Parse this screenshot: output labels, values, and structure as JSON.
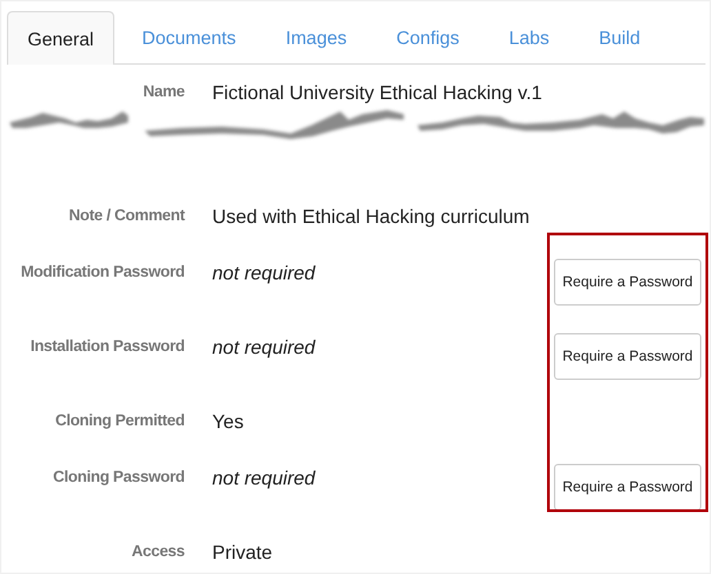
{
  "tabs": [
    {
      "label": "General",
      "selected": true
    },
    {
      "label": "Documents",
      "selected": false
    },
    {
      "label": "Images",
      "selected": false
    },
    {
      "label": "Configs",
      "selected": false
    },
    {
      "label": "Labs",
      "selected": false
    },
    {
      "label": "Build",
      "selected": false
    }
  ],
  "name_row": {
    "label": "Name",
    "value": "Fictional University Ethical Hacking v.1"
  },
  "fields": [
    {
      "label": "Note / Comment",
      "value": "Used with Ethical Hacking curriculum",
      "italic": false
    },
    {
      "label": "Modification Password",
      "value": "not required",
      "italic": true,
      "button": "Require a Password"
    },
    {
      "label": "Installation Password",
      "value": "not required",
      "italic": true,
      "button": "Require a Password"
    },
    {
      "label": "Cloning Permitted",
      "value": "Yes",
      "italic": false
    },
    {
      "label": "Cloning Password",
      "value": "not required",
      "italic": true,
      "button": "Require a Password"
    },
    {
      "label": "Access",
      "value": "Private",
      "italic": false
    }
  ]
}
